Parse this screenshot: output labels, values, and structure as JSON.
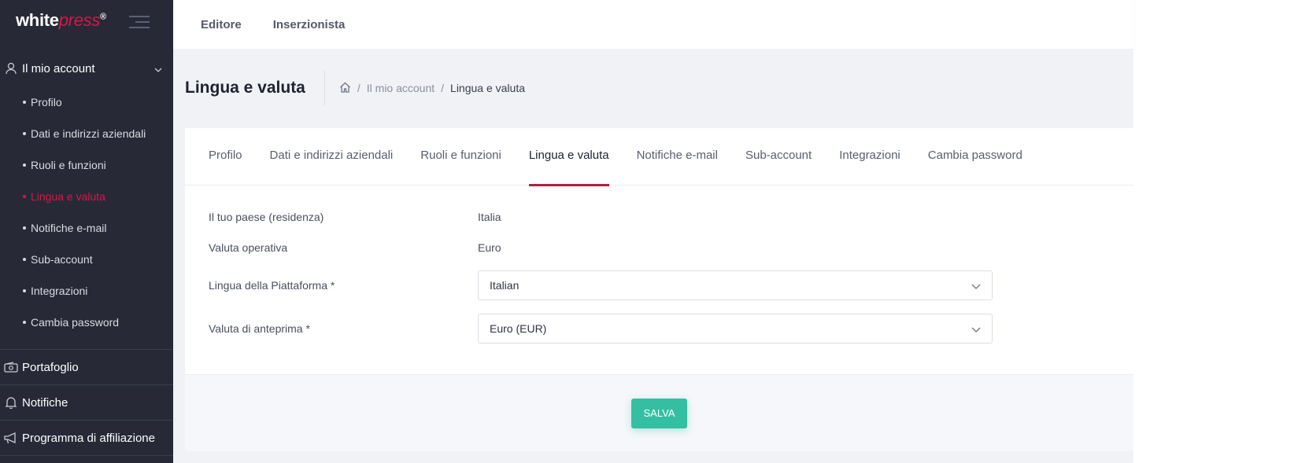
{
  "brand": {
    "logo_main": "white",
    "logo_accent": "press",
    "logo_mark": "®"
  },
  "topbar": {
    "links": [
      "Editore",
      "Inserzionista"
    ]
  },
  "sidebar": {
    "group_title": "Il mio account",
    "sub_items": [
      {
        "label": "Profilo",
        "active": false
      },
      {
        "label": "Dati e indirizzi aziendali",
        "active": false
      },
      {
        "label": "Ruoli e funzioni",
        "active": false
      },
      {
        "label": "Lingua e valuta",
        "active": true
      },
      {
        "label": "Notifiche e-mail",
        "active": false
      },
      {
        "label": "Sub-account",
        "active": false
      },
      {
        "label": "Integrazioni",
        "active": false
      },
      {
        "label": "Cambia password",
        "active": false
      }
    ],
    "main_items": [
      "Portafoglio",
      "Notifiche",
      "Programma di affiliazione"
    ]
  },
  "page": {
    "title": "Lingua e valuta",
    "breadcrumb": {
      "sep": "/",
      "parent": "Il mio account",
      "current": "Lingua e valuta"
    }
  },
  "tabs": [
    "Profilo",
    "Dati e indirizzi aziendali",
    "Ruoli e funzioni",
    "Lingua e valuta",
    "Notifiche e-mail",
    "Sub-account",
    "Integrazioni",
    "Cambia password"
  ],
  "active_tab": "Lingua e valuta",
  "form": {
    "country_label": "Il tuo paese (residenza)",
    "country_value": "Italia",
    "currency_label": "Valuta operativa",
    "currency_value": "Euro",
    "language_label": "Lingua della Piattaforma *",
    "language_value": "Italian",
    "preview_label": "Valuta di anteprima *",
    "preview_value": "Euro (EUR)"
  },
  "actions": {
    "save": "SALVA"
  },
  "colors": {
    "accent": "#d5174a",
    "tab_underline": "#b41d3f",
    "save_button": "#34bfa3",
    "sidebar_bg": "#272a36"
  }
}
